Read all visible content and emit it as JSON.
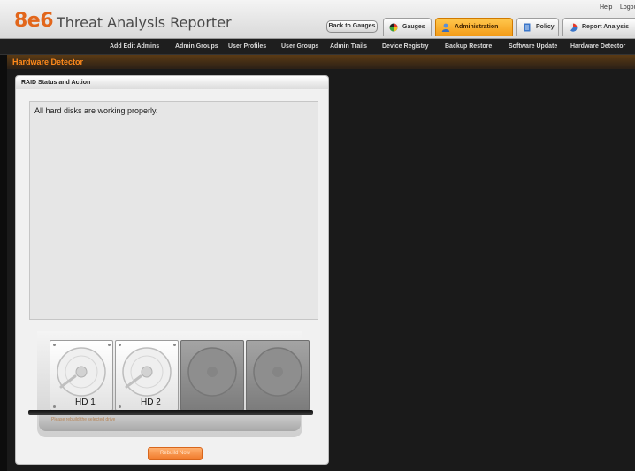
{
  "header": {
    "logo": "8e6",
    "app_title": "Threat Analysis Reporter",
    "help": "Help",
    "logout": "Logout",
    "back_button": "Back to Gauges",
    "tabs": [
      {
        "label": "Gauges",
        "icon": "gauges-icon"
      },
      {
        "label": "Administration",
        "icon": "administration-icon",
        "active": true
      },
      {
        "label": "Policy",
        "icon": "policy-icon"
      },
      {
        "label": "Report Analysis",
        "icon": "report-analysis-icon"
      }
    ]
  },
  "subnav": {
    "items": [
      "Add Edit Admins",
      "Admin Groups",
      "User Profiles",
      "User Groups",
      "Admin Trails",
      "Device Registry",
      "Backup Restore",
      "Software Update",
      "Hardware Detector"
    ]
  },
  "page": {
    "title": "Hardware Detector"
  },
  "panel": {
    "title": "RAID Status and Action",
    "status_message": "All hard disks are working properly.",
    "bay_caption": "Please rebuild the selected drive",
    "drives": [
      {
        "label": "HD 1",
        "state": "present"
      },
      {
        "label": "HD 2",
        "state": "present"
      },
      {
        "label": "",
        "state": "empty"
      },
      {
        "label": "",
        "state": "empty"
      }
    ],
    "rebuild_button": "Rebuild Now"
  },
  "colors": {
    "accent": "#ff8a1c",
    "logo": "#e2661b",
    "active_tab": "#f39a16",
    "background": "#1a1a1a"
  }
}
